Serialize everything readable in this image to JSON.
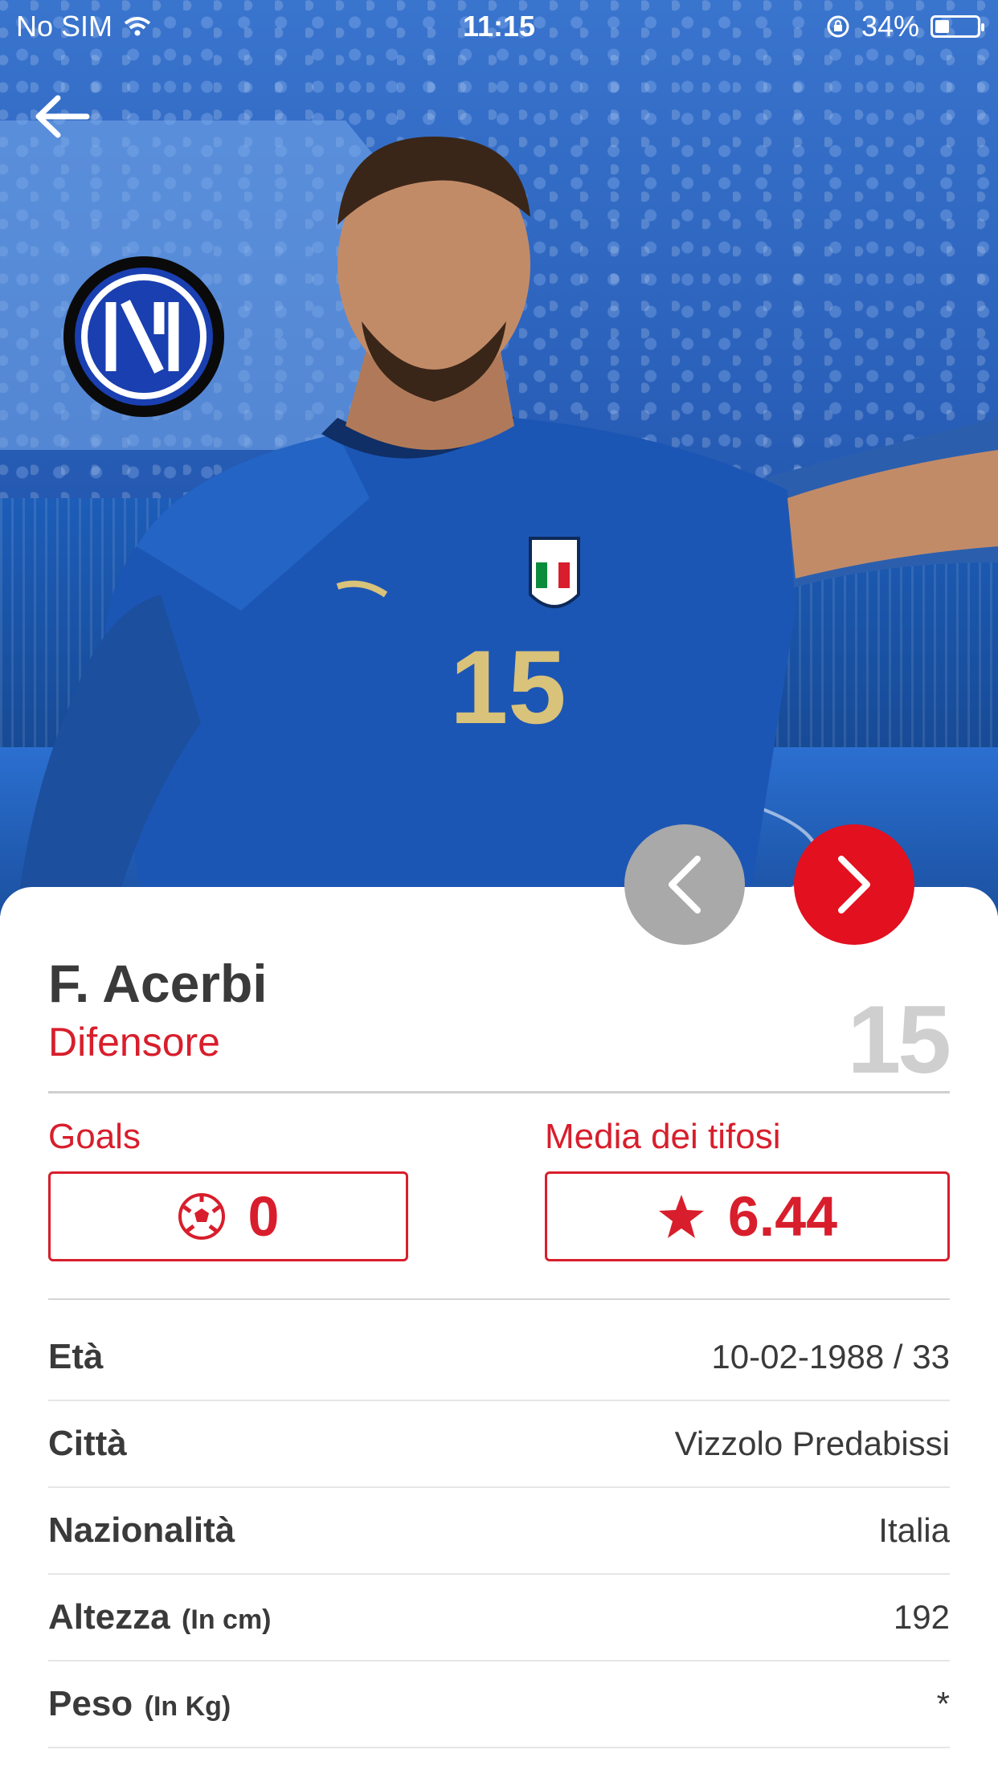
{
  "status_bar": {
    "carrier": "No SIM",
    "time": "11:15",
    "battery_percent": "34%",
    "battery_level": 0.34
  },
  "icons": {
    "back": "back-arrow-icon",
    "club_logo": "inter-logo",
    "prev": "chevron-left-icon",
    "next": "chevron-right-icon",
    "goals": "soccer-ball-icon",
    "rating": "star-icon"
  },
  "colors": {
    "accent": "#d81e2c",
    "next_button": "#e3101f",
    "prev_button": "#a9a9a9",
    "text": "#3a3a3a",
    "number": "#cfcfcf"
  },
  "player": {
    "name": "F. Acerbi",
    "role": "Difensore",
    "number": "15"
  },
  "stats": {
    "goals_label": "Goals",
    "goals_value": "0",
    "rating_label": "Media dei tifosi",
    "rating_value": "6.44"
  },
  "details": [
    {
      "label": "Età",
      "unit": "",
      "value": "10-02-1988 / 33"
    },
    {
      "label": "Città",
      "unit": "",
      "value": "Vizzolo Predabissi"
    },
    {
      "label": "Nazionalità",
      "unit": "",
      "value": "Italia"
    },
    {
      "label": "Altezza",
      "unit": "(In cm)",
      "value": "192"
    },
    {
      "label": "Peso",
      "unit": "(In Kg)",
      "value": "*"
    }
  ]
}
